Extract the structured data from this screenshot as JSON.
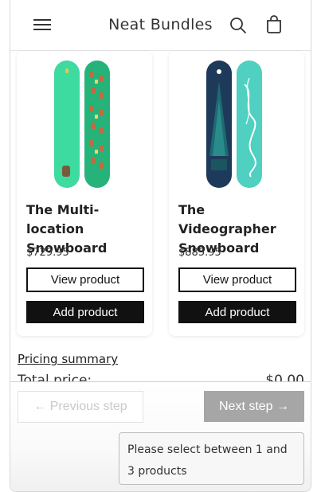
{
  "header": {
    "title": "Neat Bundles",
    "menu_icon": "hamburger-menu-icon",
    "search_icon": "search-icon",
    "cart_icon": "cart-icon"
  },
  "products": [
    {
      "name": "The Multi-location Snowboard",
      "price": "$729.95",
      "view_label": "View product",
      "add_label": "Add product"
    },
    {
      "name": "The Videographer Snowboard",
      "price": "$885.95",
      "view_label": "View product",
      "add_label": "Add product"
    }
  ],
  "pricing": {
    "summary_link": "Pricing summary",
    "total_label": "Total price:",
    "total_value": "$0.00"
  },
  "navigation": {
    "previous_label": "← Previous step",
    "next_label": "Next step →",
    "hint": "Please select between 1 and 3 products"
  },
  "colors": {
    "accent": "#111111",
    "disabled_button": "#a6a6a6",
    "board_green": "#3ddba0",
    "board_teal": "#2fc0b0",
    "board_navy": "#1e3a5a"
  }
}
